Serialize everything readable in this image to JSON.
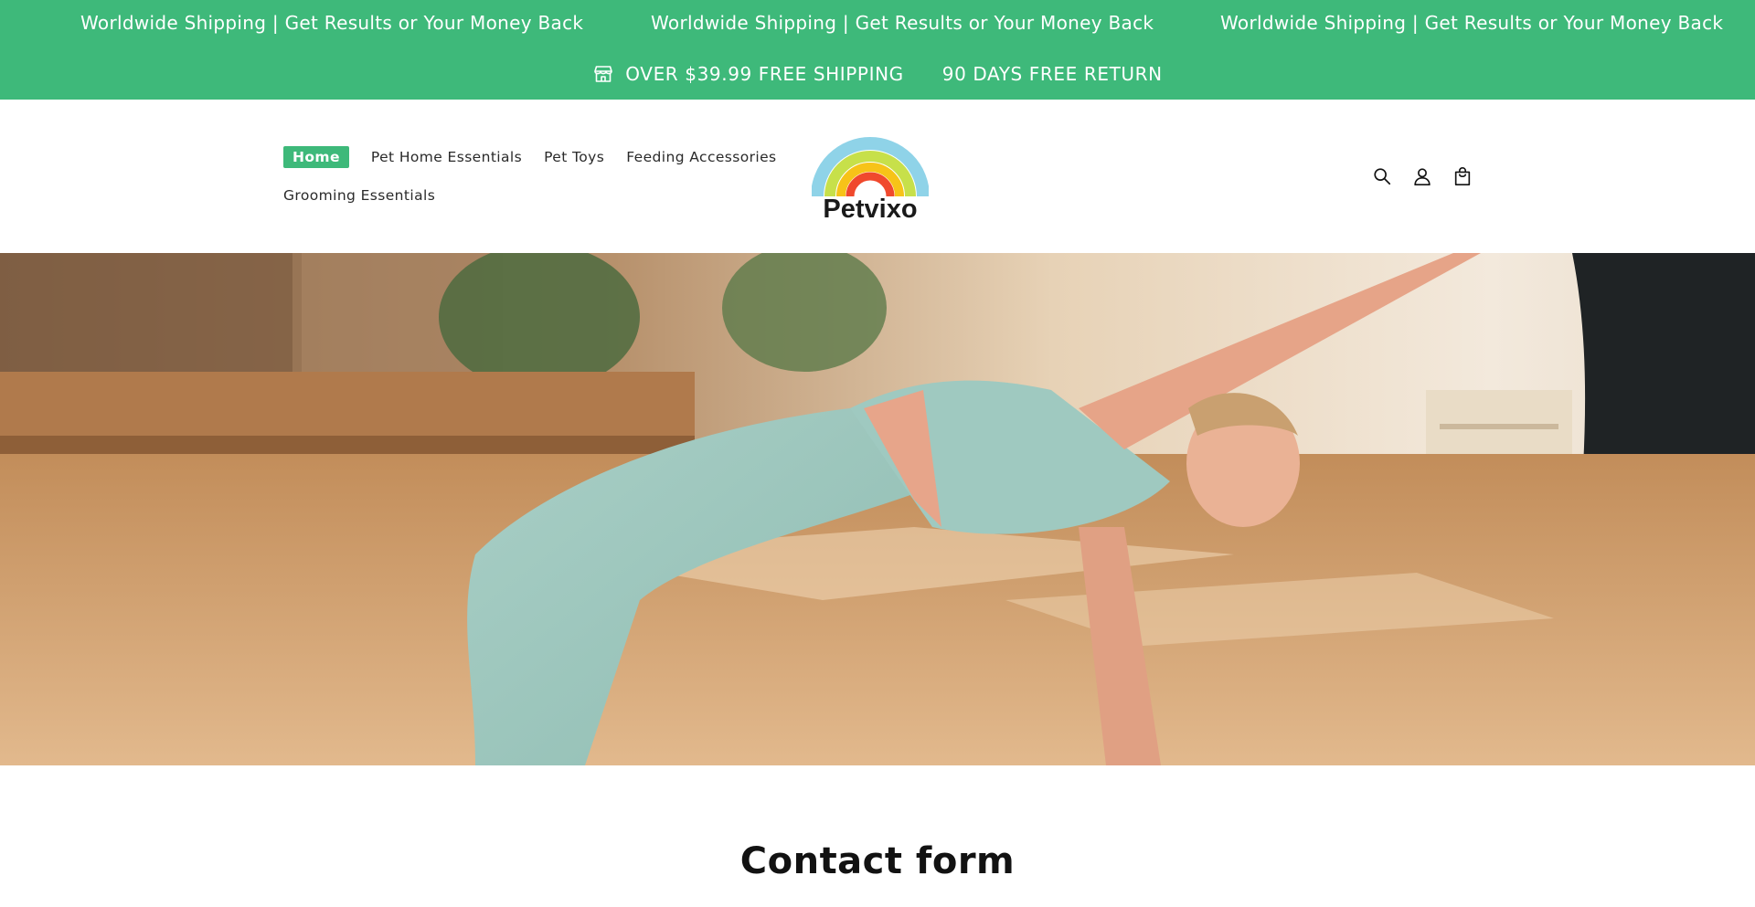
{
  "announcement": {
    "marquee": [
      "Worldwide Shipping | Get Results or Your Money Back",
      "Worldwide Shipping | Get Results or Your Money Back",
      "Worldwide Shipping | Get Results or Your Money Back"
    ],
    "perks": [
      {
        "icon": "store-icon",
        "label": "OVER $39.99 FREE SHIPPING"
      },
      {
        "label": "90 DAYS FREE RETURN"
      }
    ],
    "bg_color": "#3eb97a"
  },
  "header": {
    "nav": [
      {
        "label": "Home",
        "active": true
      },
      {
        "label": "Pet Home Essentials"
      },
      {
        "label": "Pet Toys"
      },
      {
        "label": "Feeding Accessories"
      },
      {
        "label": "Grooming Essentials"
      }
    ],
    "logo_text": "Petvixo",
    "icons": [
      "search-icon",
      "account-icon",
      "cart-icon"
    ]
  },
  "hero": {
    "image": "yoga-side-plank-photo"
  },
  "contact": {
    "title": "Contact form"
  }
}
